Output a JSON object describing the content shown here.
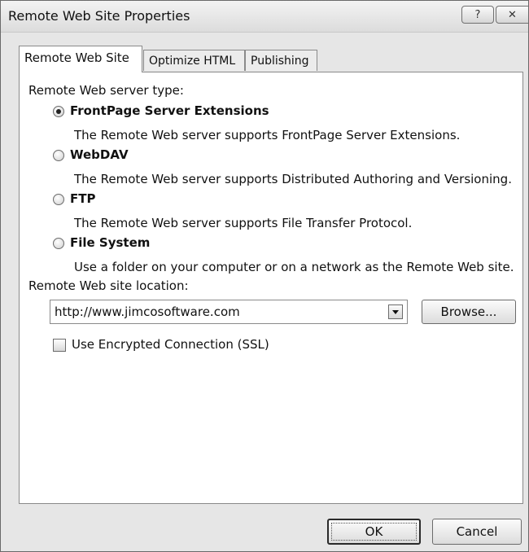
{
  "window": {
    "title": "Remote Web Site Properties",
    "help_label": "?",
    "close_label": "✕"
  },
  "tabs": [
    {
      "label": "Remote Web Site",
      "active": true
    },
    {
      "label": "Optimize HTML",
      "active": false
    },
    {
      "label": "Publishing",
      "active": false
    }
  ],
  "server_type": {
    "heading": "Remote Web server type:",
    "selected": "FrontPage Server Extensions",
    "options": [
      {
        "title": "FrontPage Server Extensions",
        "description": "The Remote Web server supports FrontPage Server Extensions."
      },
      {
        "title": "WebDAV",
        "description": "The Remote Web server supports Distributed Authoring and Versioning."
      },
      {
        "title": "FTP",
        "description": "The Remote Web server supports File Transfer Protocol."
      },
      {
        "title": "File System",
        "description": "Use a folder on your computer or on a network as the Remote Web site."
      }
    ]
  },
  "location": {
    "label": "Remote Web site location:",
    "value": "http://www.jimcosoftware.com",
    "browse_label": "Browse..."
  },
  "ssl": {
    "label": "Use Encrypted Connection (SSL)",
    "checked": false
  },
  "buttons": {
    "ok_label": "OK",
    "cancel_label": "Cancel"
  }
}
